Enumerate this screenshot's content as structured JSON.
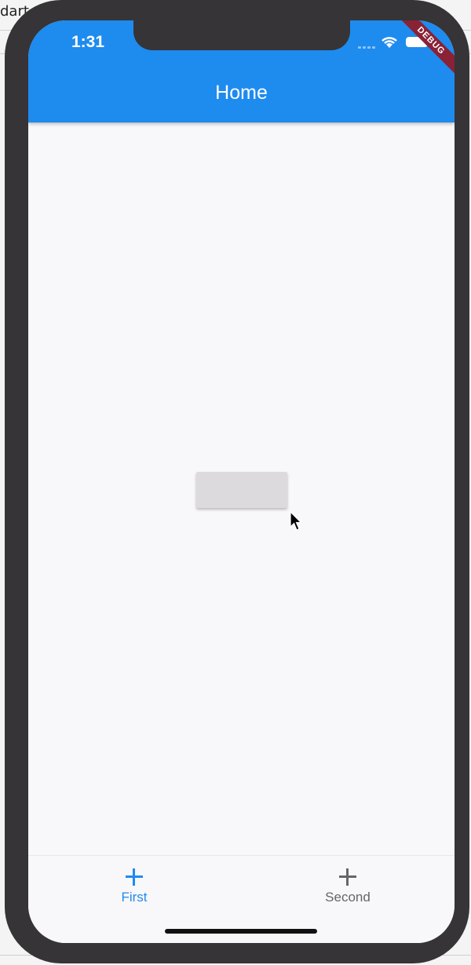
{
  "background": {
    "editor_text": "dart"
  },
  "status_bar": {
    "time": "1:31",
    "debug_label": "DEBUG"
  },
  "app_bar": {
    "title": "Home",
    "color": "#1e8bef"
  },
  "bottom_nav": {
    "items": [
      {
        "label": "First",
        "icon": "plus-icon",
        "active": true,
        "color": "#1e8bef"
      },
      {
        "label": "Second",
        "icon": "plus-icon",
        "active": false,
        "color": "#666666"
      }
    ]
  }
}
